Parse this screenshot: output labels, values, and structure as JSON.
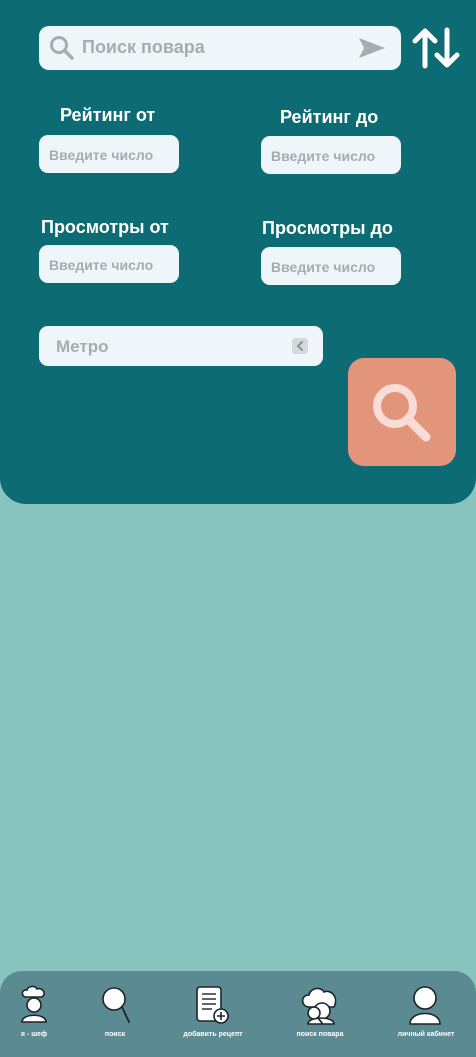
{
  "search": {
    "placeholder": "Поиск повара",
    "icon": "search-icon",
    "send_icon": "send-icon",
    "sort_icon": "sort-icon"
  },
  "filters": {
    "rating_from_label": "Рейтинг от",
    "rating_to_label": "Рейтинг до",
    "views_from_label": "Просмотры от",
    "views_to_label": "Просмотры до",
    "number_placeholder": "Введите число",
    "metro_placeholder": "Метро"
  },
  "actions": {
    "search_button_icon": "search-icon"
  },
  "nav": {
    "items": [
      {
        "label": "я - шеф",
        "icon": "chef-icon"
      },
      {
        "label": "поиск",
        "icon": "search-icon"
      },
      {
        "label": "добавить рецепт",
        "icon": "add-recipe-icon"
      },
      {
        "label": "поиск повара",
        "icon": "chef-search-icon"
      },
      {
        "label": "личный кабинет",
        "icon": "user-icon"
      }
    ]
  },
  "colors": {
    "panel": "#0d6b73",
    "background": "#88c4be",
    "input": "#eef6f9",
    "search_button": "#e2957a",
    "nav": "#5c8a92"
  }
}
